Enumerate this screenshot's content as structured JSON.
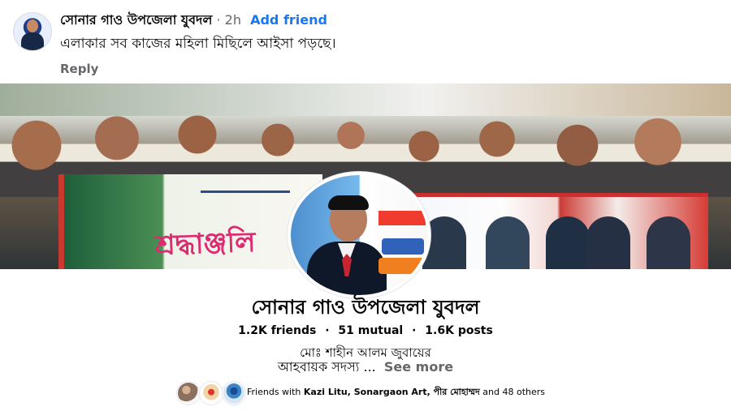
{
  "comment": {
    "author": "সোনার গাও উপজেলা যুবদল",
    "separator": "·",
    "time": "2h",
    "add_friend": "Add friend",
    "text": "এলাকার সব কাজের মহিলা মিছিলে আইসা পড়ছে।",
    "reply": "Reply"
  },
  "cover_banner": {
    "left_banner_text": "শ্রদ্ধাঞ্জলি"
  },
  "profile": {
    "name": "সোনার গাও উপজেলা যুবদল",
    "friends": "1.2K friends",
    "mutual": "51 mutual",
    "posts": "1.6K posts",
    "intro_line1": "মোঃ শাহীন আলম জুবায়ের",
    "intro_line2": "আহবায়ক সদস্য ...",
    "see_more": "See more"
  },
  "friends_preview": {
    "prefix": "Friends with",
    "names": "Kazi Litu, Sonargaon Art, পীর মোহাম্মদ",
    "suffix": "and 48 others"
  },
  "colors": {
    "link_blue": "#1877f2",
    "muted_gray": "#65676b",
    "text_dark": "#050505"
  }
}
